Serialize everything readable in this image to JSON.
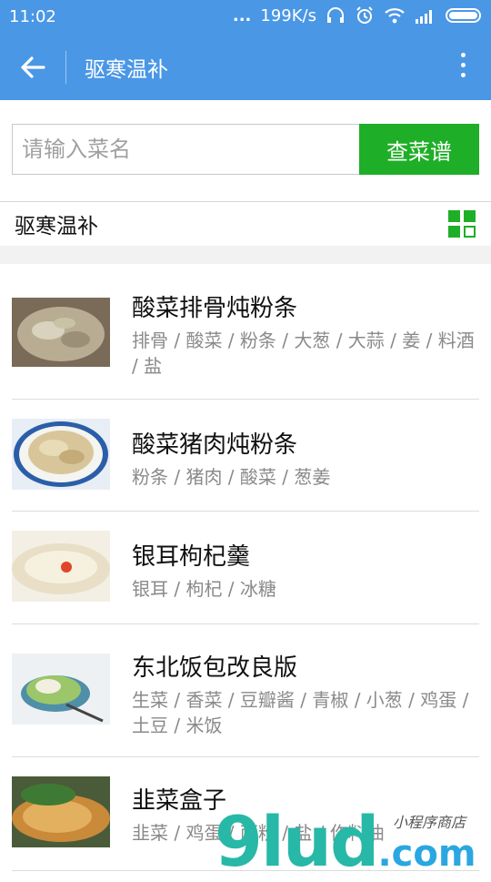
{
  "status_bar": {
    "time": "11:02",
    "dots": "...",
    "speed": "199K/s"
  },
  "app_bar": {
    "title": "驱寒温补"
  },
  "search": {
    "placeholder": "请输入菜名",
    "button_label": "查菜谱"
  },
  "section": {
    "title": "驱寒温补"
  },
  "recipes": [
    {
      "name": "酸菜排骨炖粉条",
      "ingredients": "排骨 / 酸菜 / 粉条 / 大葱 / 大蒜 / 姜 / 料酒 / 盐"
    },
    {
      "name": "酸菜猪肉炖粉条",
      "ingredients": "粉条 / 猪肉 / 酸菜 / 葱姜"
    },
    {
      "name": "银耳枸杞羹",
      "ingredients": "银耳 / 枸杞 / 冰糖"
    },
    {
      "name": "东北饭包改良版",
      "ingredients": "生菜 / 香菜 / 豆瓣酱 / 青椒 / 小葱 / 鸡蛋 / 土豆 / 米饭"
    },
    {
      "name": "韭菜盒子",
      "ingredients": "韭菜 / 鸡蛋 / 面粉 / 盐 / 作料油"
    }
  ],
  "watermark": {
    "main": "9lud",
    "suffix": ".com",
    "slogan": "小程序商店"
  },
  "colors": {
    "app_bar": "#4a97e6",
    "search_button": "#1fae27",
    "grid_icon": "#1fae27"
  }
}
